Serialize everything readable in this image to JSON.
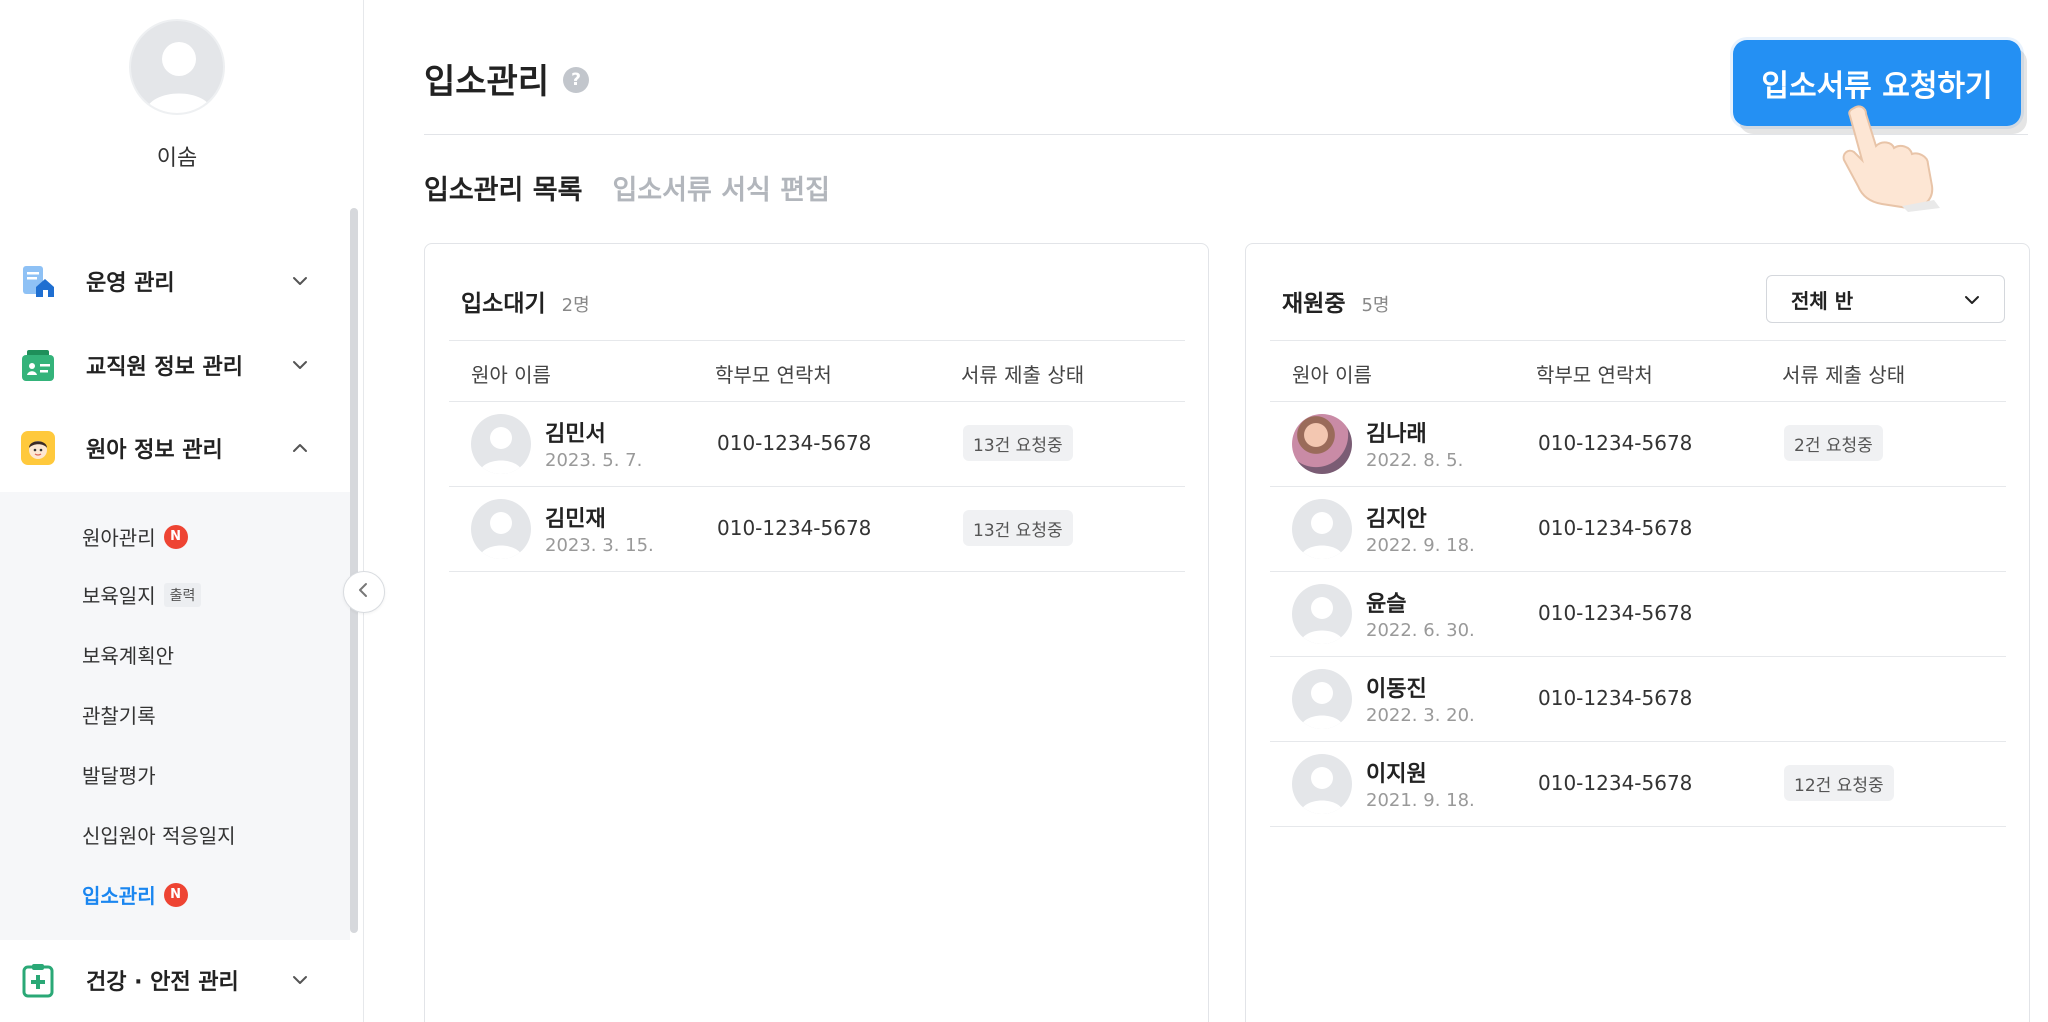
{
  "profile": {
    "name": "이솜"
  },
  "sidebar": {
    "menus": [
      {
        "label": "운영 관리"
      },
      {
        "label": "교직원 정보 관리"
      },
      {
        "label": "원아 정보 관리"
      },
      {
        "label": "건강 · 안전 관리"
      }
    ],
    "submenu": [
      {
        "label": "원아관리",
        "badge": "N"
      },
      {
        "label": "보육일지",
        "tag": "출력"
      },
      {
        "label": "보육계획안"
      },
      {
        "label": "관찰기록"
      },
      {
        "label": "발달평가"
      },
      {
        "label": "신입원아 적응일지"
      },
      {
        "label": "입소관리",
        "badge": "N"
      }
    ]
  },
  "page": {
    "title": "입소관리",
    "help": "?",
    "request_button": "입소서류 요청하기",
    "tabs": [
      {
        "label": "입소관리 목록"
      },
      {
        "label": "입소서류 서식 편집"
      }
    ]
  },
  "waiting": {
    "title": "입소대기",
    "count": "2명",
    "columns": [
      "원아 이름",
      "학부모 연락처",
      "서류 제출 상태"
    ],
    "rows": [
      {
        "name": "김민서",
        "birth": "2023. 5. 7.",
        "phone": "010-1234-5678",
        "status": "13건 요청중"
      },
      {
        "name": "김민재",
        "birth": "2023. 3. 15.",
        "phone": "010-1234-5678",
        "status": "13건 요청중"
      }
    ]
  },
  "enrolled": {
    "title": "재원중",
    "count": "5명",
    "class_select": "전체 반",
    "columns": [
      "원아 이름",
      "학부모 연락처",
      "서류 제출 상태"
    ],
    "rows": [
      {
        "name": "김나래",
        "birth": "2022. 8. 5.",
        "phone": "010-1234-5678",
        "status": "2건 요청중"
      },
      {
        "name": "김지안",
        "birth": "2022. 9. 18.",
        "phone": "010-1234-5678",
        "status": ""
      },
      {
        "name": "윤슬",
        "birth": "2022. 6. 30.",
        "phone": "010-1234-5678",
        "status": ""
      },
      {
        "name": "이동진",
        "birth": "2022. 3. 20.",
        "phone": "010-1234-5678",
        "status": ""
      },
      {
        "name": "이지원",
        "birth": "2021. 9. 18.",
        "phone": "010-1234-5678",
        "status": "12건 요청중"
      }
    ]
  },
  "colors": {
    "accent": "#2490f3",
    "active_text": "#1a86f0",
    "badge": "#ee4433"
  }
}
